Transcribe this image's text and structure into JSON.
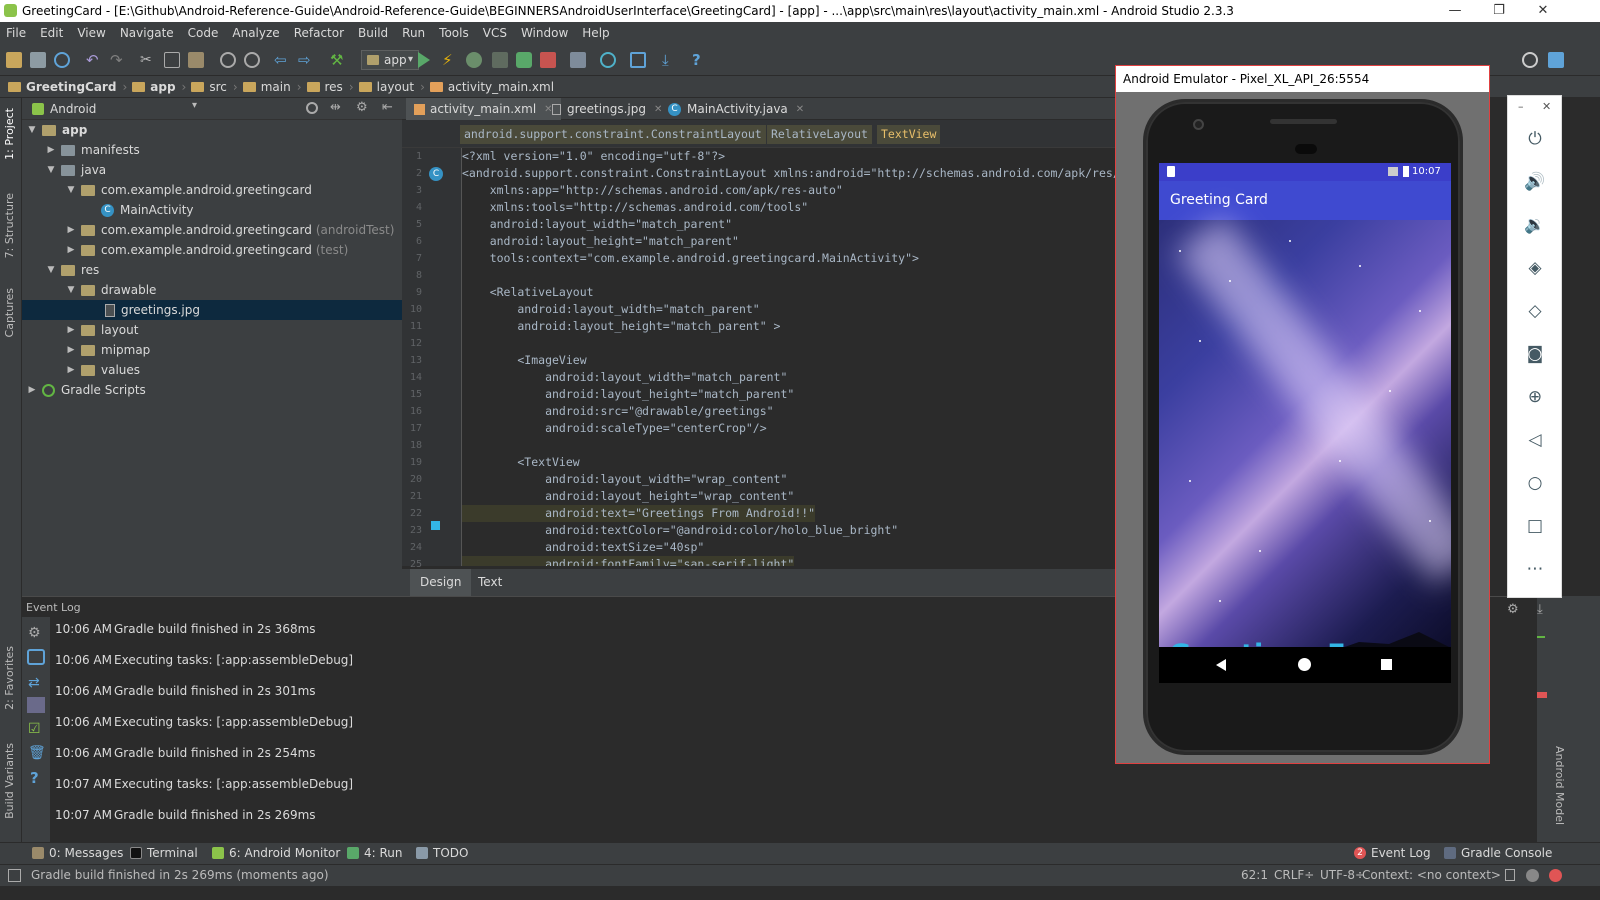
{
  "window": {
    "title": "GreetingCard - [E:\\Github\\Android-Reference-Guide\\Android-Reference-Guide\\BEGINNERSAndroidUserInterface\\GreetingCard] - [app] - ...\\app\\src\\main\\res\\layout\\activity_main.xml - Android Studio 2.3.3",
    "minimize": "—",
    "restore": "❐",
    "close": "✕"
  },
  "menu": [
    "File",
    "Edit",
    "View",
    "Navigate",
    "Code",
    "Analyze",
    "Refactor",
    "Build",
    "Run",
    "Tools",
    "VCS",
    "Window",
    "Help"
  ],
  "toolbar": {
    "config": "app"
  },
  "breadcrumbs": [
    "GreetingCard",
    "app",
    "src",
    "main",
    "res",
    "layout",
    "activity_main.xml"
  ],
  "left_strip": {
    "project": "1: Project",
    "structure": "7: Structure",
    "captures": "Captures",
    "favorites": "2: Favorites",
    "build_variants": "Build Variants"
  },
  "project": {
    "view": "Android",
    "tree": [
      {
        "label": "app",
        "extra": ""
      },
      {
        "label": "manifests",
        "extra": ""
      },
      {
        "label": "java",
        "extra": ""
      },
      {
        "label": "com.example.android.greetingcard",
        "extra": ""
      },
      {
        "label": "MainActivity",
        "extra": ""
      },
      {
        "label": "com.example.android.greetingcard",
        "extra": "(androidTest)"
      },
      {
        "label": "com.example.android.greetingcard",
        "extra": "(test)"
      },
      {
        "label": "res",
        "extra": ""
      },
      {
        "label": "drawable",
        "extra": ""
      },
      {
        "label": "greetings.jpg",
        "extra": ""
      },
      {
        "label": "layout",
        "extra": ""
      },
      {
        "label": "mipmap",
        "extra": ""
      },
      {
        "label": "values",
        "extra": ""
      },
      {
        "label": "Gradle Scripts",
        "extra": ""
      }
    ]
  },
  "editor": {
    "tabs": [
      "activity_main.xml",
      "greetings.jpg",
      "MainActivity.java"
    ],
    "xml_path": [
      "android.support.constraint.ConstraintLayout",
      "RelativeLayout",
      "TextView"
    ],
    "line_numbers": [
      "1",
      "2",
      "3",
      "4",
      "5",
      "6",
      "7",
      "8",
      "9",
      "10",
      "11",
      "12",
      "13",
      "14",
      "15",
      "16",
      "17",
      "18",
      "19",
      "20",
      "21",
      "22",
      "23",
      "24",
      "25"
    ],
    "code": [
      "<?xml version=\"1.0\" encoding=\"utf-8\"?>",
      "<android.support.constraint.ConstraintLayout xmlns:android=\"http://schemas.android.com/apk/res/",
      "    xmlns:app=\"http://schemas.android.com/apk/res-auto\"",
      "    xmlns:tools=\"http://schemas.android.com/tools\"",
      "    android:layout_width=\"match_parent\"",
      "    android:layout_height=\"match_parent\"",
      "    tools:context=\"com.example.android.greetingcard.MainActivity\">",
      "",
      "    <RelativeLayout",
      "        android:layout_width=\"match_parent\"",
      "        android:layout_height=\"match_parent\" >",
      "",
      "        <ImageView",
      "            android:layout_width=\"match_parent\"",
      "            android:layout_height=\"match_parent\"",
      "            android:src=\"@drawable/greetings\"",
      "            android:scaleType=\"centerCrop\"/>",
      "",
      "        <TextView",
      "            android:layout_width=\"wrap_content\"",
      "            android:layout_height=\"wrap_content\"",
      "            android:text=\"Greetings From Android!!\"",
      "            android:textColor=\"@android:color/holo_blue_bright\"",
      "            android:textSize=\"40sp\"",
      "            android:fontFamily=\"san-serif-light\""
    ],
    "bottom_tabs": [
      "Design",
      "Text"
    ]
  },
  "event_log": {
    "title": "Event Log",
    "entries": [
      {
        "time": "10:06 AM",
        "text": "Gradle build finished in 2s 368ms"
      },
      {
        "time": "10:06 AM",
        "text": "Executing tasks: [:app:assembleDebug]"
      },
      {
        "time": "10:06 AM",
        "text": "Gradle build finished in 2s 301ms"
      },
      {
        "time": "10:06 AM",
        "text": "Executing tasks: [:app:assembleDebug]"
      },
      {
        "time": "10:06 AM",
        "text": "Gradle build finished in 2s 254ms"
      },
      {
        "time": "10:07 AM",
        "text": "Executing tasks: [:app:assembleDebug]"
      },
      {
        "time": "10:07 AM",
        "text": "Gradle build finished in 2s 269ms"
      }
    ]
  },
  "right_strip": {
    "android_model": "Android Model"
  },
  "bottom_tools": {
    "messages": "0: Messages",
    "terminal": "Terminal",
    "monitor": "6: Android Monitor",
    "run": "4: Run",
    "todo": "TODO",
    "event_log": "Event Log",
    "event_count": "2",
    "gradle_console": "Gradle Console"
  },
  "status": {
    "message": "Gradle build finished in 2s 269ms (moments ago)",
    "position": "62:1",
    "line_sep": "CRLF÷",
    "encoding": "UTF-8÷",
    "context": "Context: <no context>"
  },
  "emulator": {
    "title": "Android Emulator - Pixel_XL_API_26:5554",
    "time": "10:07",
    "app_title": "Greeting Card",
    "greeting": "Greetings From Android!!",
    "side_minimize": "–",
    "side_close": "✕"
  },
  "colors": {
    "accent": "#3f4ad0",
    "greeting_text": "#33b5e5",
    "selected_row": "#0d293e",
    "run_green": "#59a869",
    "stop_red": "#c75450"
  }
}
